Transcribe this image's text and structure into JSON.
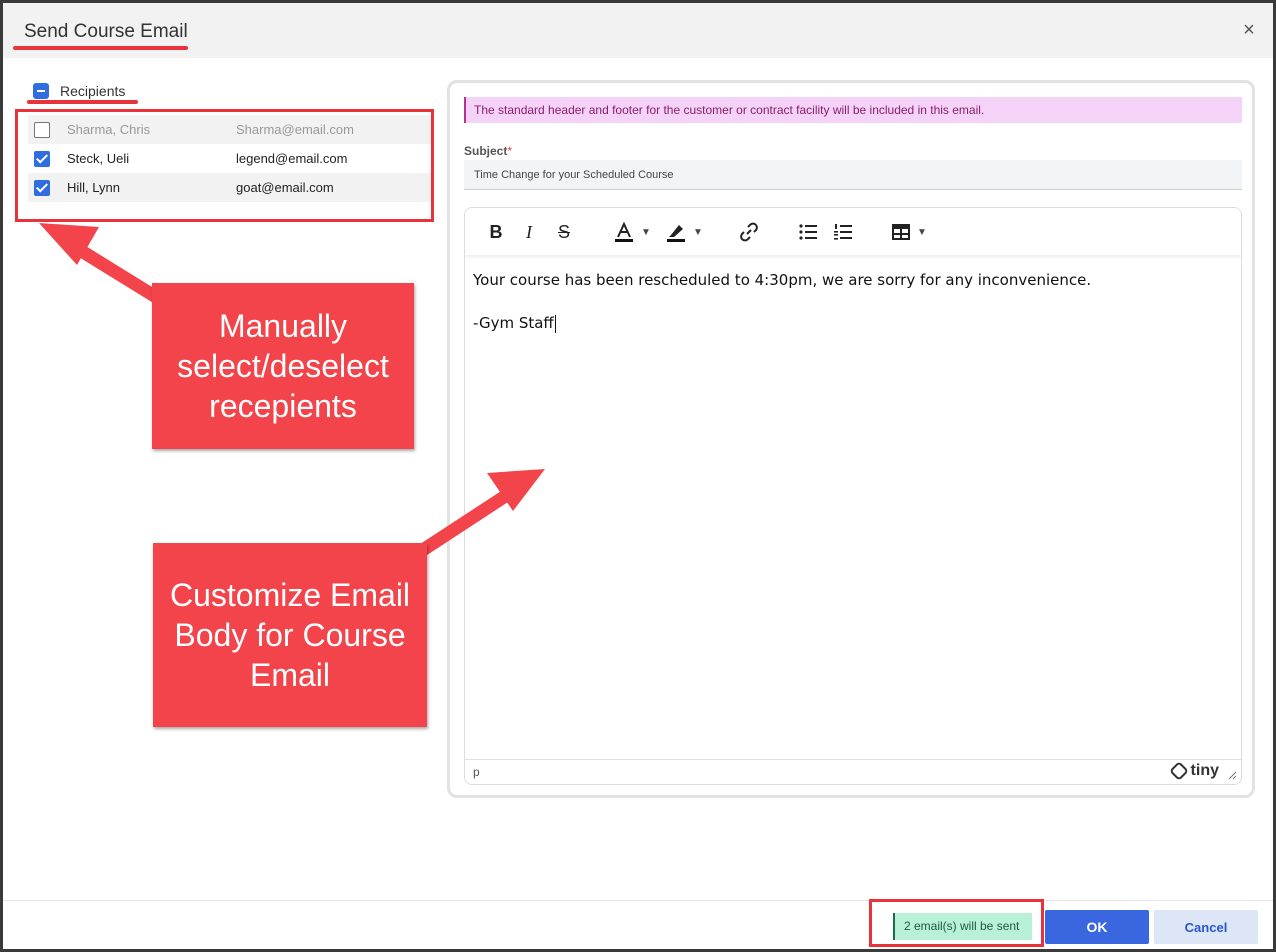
{
  "dialog": {
    "title": "Send Course Email",
    "close_glyph": "×"
  },
  "recipients": {
    "label": "Recipients",
    "select_all_state": "indeterminate",
    "items": [
      {
        "name": "Sharma, Chris",
        "email": "Sharma@email.com",
        "checked": false
      },
      {
        "name": "Steck, Ueli",
        "email": "legend@email.com",
        "checked": true
      },
      {
        "name": "Hill, Lynn",
        "email": "goat@email.com",
        "checked": true
      }
    ]
  },
  "callouts": {
    "recipients_note": "Manually select/deselect recepients",
    "body_note": "Customize Email Body for Course Email"
  },
  "notice": "The standard header and footer for the customer or contract facility will be included in this email.",
  "subject": {
    "label": "Subject",
    "required_mark": "*",
    "value": "Time Change for your Scheduled Course"
  },
  "editor": {
    "toolbar": {
      "bold": "B",
      "italic": "I",
      "strike": "S"
    },
    "body_lines": [
      "Your course has been rescheduled to 4:30pm, we are sorry for any inconvenience.",
      "-Gym Staff"
    ],
    "status_path": "p",
    "brand": "tiny"
  },
  "footer": {
    "count_text": "2 email(s) will be sent",
    "ok_label": "OK",
    "cancel_label": "Cancel"
  },
  "colors": {
    "accent": "#3a67e0",
    "annotation_red": "#e8323c",
    "notice_bg": "#f5d3f8",
    "count_bg": "#b8f0d8"
  }
}
